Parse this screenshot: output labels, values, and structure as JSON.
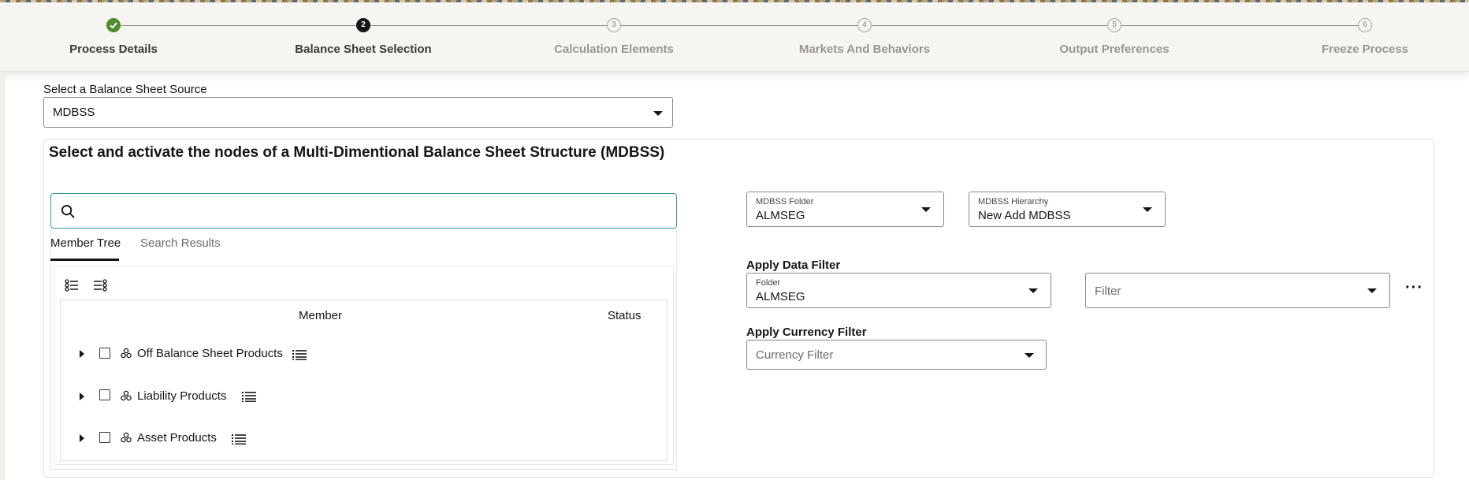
{
  "train": {
    "steps": [
      {
        "label": "Process Details",
        "number": "✓",
        "state": "done"
      },
      {
        "label": "Balance Sheet Selection",
        "number": "2",
        "state": "current"
      },
      {
        "label": "Calculation Elements",
        "number": "3",
        "state": "future"
      },
      {
        "label": "Markets And Behaviors",
        "number": "4",
        "state": "future"
      },
      {
        "label": "Output Preferences",
        "number": "5",
        "state": "future"
      },
      {
        "label": "Freeze Process",
        "number": "6",
        "state": "future"
      }
    ]
  },
  "source": {
    "label": "Select a Balance Sheet Source",
    "value": "MDBSS"
  },
  "panel": {
    "title": "Select and activate the nodes of a Multi-Dimentional Balance Sheet Structure (MDBSS)"
  },
  "search": {
    "placeholder": ""
  },
  "tabs": {
    "member_tree": "Member Tree",
    "search_results": "Search Results"
  },
  "tree": {
    "col_member": "Member",
    "col_status": "Status",
    "rows": [
      {
        "label": "Off Balance Sheet Products"
      },
      {
        "label": "Liability Products"
      },
      {
        "label": "Asset Products"
      }
    ]
  },
  "mdbss_folder": {
    "label": "MDBSS Folder",
    "value": "ALMSEG"
  },
  "mdbss_hierarchy": {
    "label": "MDBSS Hierarchy",
    "value": "New Add MDBSS"
  },
  "data_filter": {
    "section_label": "Apply Data Filter",
    "folder_label": "Folder",
    "folder_value": "ALMSEG",
    "filter_placeholder": "Filter",
    "more": "···"
  },
  "currency_filter": {
    "section_label": "Apply Currency Filter",
    "placeholder": "Currency Filter"
  },
  "colors": {
    "done": "#4f8d2e",
    "current": "#161513",
    "focus": "#2f9b9b"
  }
}
